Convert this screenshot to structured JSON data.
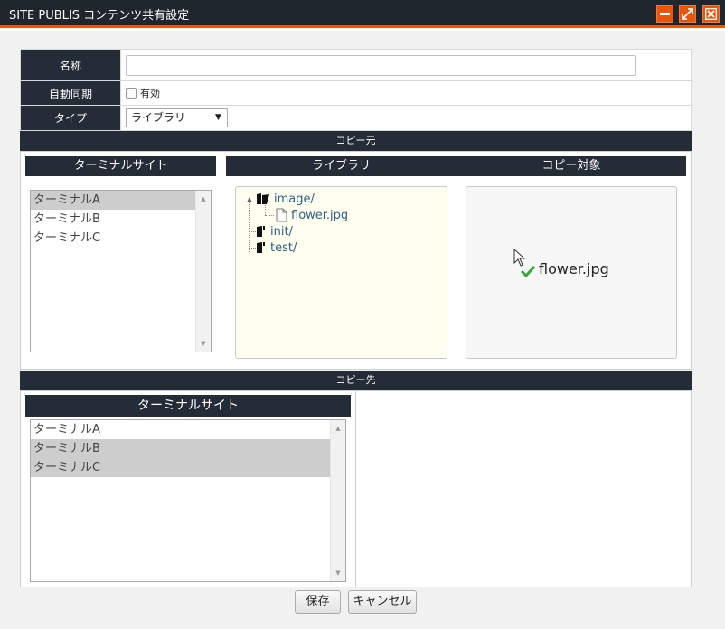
{
  "window": {
    "title": "SITE PUBLIS コンテンツ共有設定"
  },
  "form": {
    "name_label": "名称",
    "name_value": "",
    "sync_label": "自動同期",
    "sync_checkbox_label": "有効",
    "sync_checked": false,
    "type_label": "タイプ",
    "type_selected": "ライブラリ"
  },
  "source": {
    "section_title": "コピー元",
    "terminal_header": "ターミナルサイト",
    "terminals": [
      {
        "label": "ターミナルA",
        "selected": true
      },
      {
        "label": "ターミナルB",
        "selected": false
      },
      {
        "label": "ターミナルC",
        "selected": false
      }
    ],
    "library_header": "ライブラリ",
    "tree": {
      "root": "image/",
      "child": "flower.jpg",
      "folder2": "init/",
      "folder3": "test/"
    },
    "target_header": "コピー対象",
    "target_item": "flower.jpg"
  },
  "destination": {
    "section_title": "コピー先",
    "terminal_header": "ターミナルサイト",
    "terminals": [
      {
        "label": "ターミナルA",
        "selected": false
      },
      {
        "label": "ターミナルB",
        "selected": true
      },
      {
        "label": "ターミナルC",
        "selected": true
      }
    ]
  },
  "buttons": {
    "save": "保存",
    "cancel": "キャンセル"
  },
  "colors": {
    "header_bg": "#242c38",
    "accent": "#e8560e",
    "tree_bg": "#fffff0"
  }
}
